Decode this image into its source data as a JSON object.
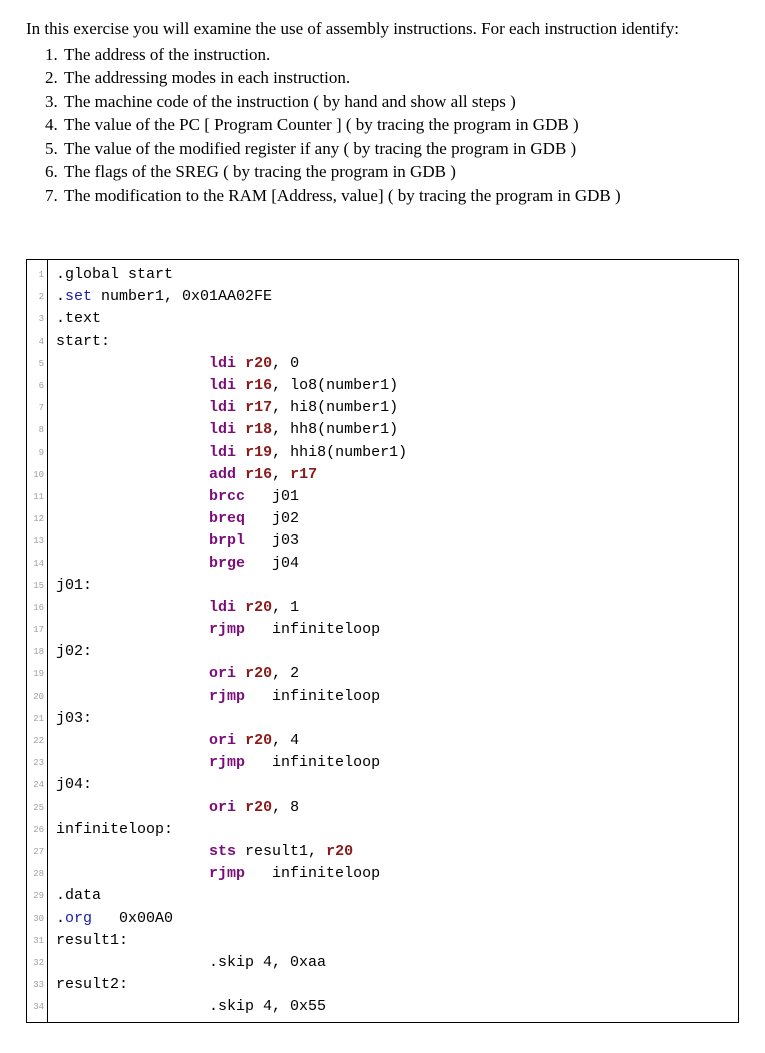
{
  "intro": "In this exercise you will examine the use of assembly instructions. For each instruction identify:",
  "list": [
    "The address of the instruction.",
    "The addressing modes in each instruction.",
    "The machine code of the instruction ( by hand and show all steps )",
    "The value of the PC [ Program Counter ] ( by tracing the program in GDB )",
    "The value of the modified register if any ( by tracing the program in GDB )",
    "The flags of the SREG ( by tracing the program in GDB )",
    "The modification to the RAM [Address, value] ( by tracing the program in GDB )"
  ],
  "code": [
    [
      {
        "t": ".global start",
        "c": "tok-plain"
      }
    ],
    [
      {
        "t": ".",
        "c": "tok-plain"
      },
      {
        "t": "set",
        "c": "tok-dir"
      },
      {
        "t": " number1, 0x01AA02FE",
        "c": "tok-plain"
      }
    ],
    [
      {
        "t": ".text",
        "c": "tok-plain"
      }
    ],
    [
      {
        "t": "start:",
        "c": "tok-plain"
      }
    ],
    [
      {
        "t": "                 ",
        "c": "tok-plain"
      },
      {
        "t": "ldi",
        "c": "tok-op"
      },
      {
        "t": " ",
        "c": "tok-plain"
      },
      {
        "t": "r20",
        "c": "tok-reg"
      },
      {
        "t": ", 0",
        "c": "tok-plain"
      }
    ],
    [
      {
        "t": "                 ",
        "c": "tok-plain"
      },
      {
        "t": "ldi",
        "c": "tok-op"
      },
      {
        "t": " ",
        "c": "tok-plain"
      },
      {
        "t": "r16",
        "c": "tok-reg"
      },
      {
        "t": ", lo8(number1)",
        "c": "tok-plain"
      }
    ],
    [
      {
        "t": "                 ",
        "c": "tok-plain"
      },
      {
        "t": "ldi",
        "c": "tok-op"
      },
      {
        "t": " ",
        "c": "tok-plain"
      },
      {
        "t": "r17",
        "c": "tok-reg"
      },
      {
        "t": ", hi8(number1)",
        "c": "tok-plain"
      }
    ],
    [
      {
        "t": "                 ",
        "c": "tok-plain"
      },
      {
        "t": "ldi",
        "c": "tok-op"
      },
      {
        "t": " ",
        "c": "tok-plain"
      },
      {
        "t": "r18",
        "c": "tok-reg"
      },
      {
        "t": ", hh8(number1)",
        "c": "tok-plain"
      }
    ],
    [
      {
        "t": "                 ",
        "c": "tok-plain"
      },
      {
        "t": "ldi",
        "c": "tok-op"
      },
      {
        "t": " ",
        "c": "tok-plain"
      },
      {
        "t": "r19",
        "c": "tok-reg"
      },
      {
        "t": ", hhi8(number1)",
        "c": "tok-plain"
      }
    ],
    [
      {
        "t": "                 ",
        "c": "tok-plain"
      },
      {
        "t": "add",
        "c": "tok-op"
      },
      {
        "t": " ",
        "c": "tok-plain"
      },
      {
        "t": "r16",
        "c": "tok-reg"
      },
      {
        "t": ", ",
        "c": "tok-plain"
      },
      {
        "t": "r17",
        "c": "tok-reg"
      }
    ],
    [
      {
        "t": "                 ",
        "c": "tok-plain"
      },
      {
        "t": "brcc",
        "c": "tok-op"
      },
      {
        "t": "   j01",
        "c": "tok-plain"
      }
    ],
    [
      {
        "t": "                 ",
        "c": "tok-plain"
      },
      {
        "t": "breq",
        "c": "tok-op"
      },
      {
        "t": "   j02",
        "c": "tok-plain"
      }
    ],
    [
      {
        "t": "                 ",
        "c": "tok-plain"
      },
      {
        "t": "brpl",
        "c": "tok-op"
      },
      {
        "t": "   j03",
        "c": "tok-plain"
      }
    ],
    [
      {
        "t": "                 ",
        "c": "tok-plain"
      },
      {
        "t": "brge",
        "c": "tok-op"
      },
      {
        "t": "   j04",
        "c": "tok-plain"
      }
    ],
    [
      {
        "t": "j01:",
        "c": "tok-plain"
      }
    ],
    [
      {
        "t": "                 ",
        "c": "tok-plain"
      },
      {
        "t": "ldi",
        "c": "tok-op"
      },
      {
        "t": " ",
        "c": "tok-plain"
      },
      {
        "t": "r20",
        "c": "tok-reg"
      },
      {
        "t": ", 1",
        "c": "tok-plain"
      }
    ],
    [
      {
        "t": "                 ",
        "c": "tok-plain"
      },
      {
        "t": "rjmp",
        "c": "tok-op"
      },
      {
        "t": "   infiniteloop",
        "c": "tok-plain"
      }
    ],
    [
      {
        "t": "j02:",
        "c": "tok-plain"
      }
    ],
    [
      {
        "t": "                 ",
        "c": "tok-plain"
      },
      {
        "t": "ori",
        "c": "tok-op"
      },
      {
        "t": " ",
        "c": "tok-plain"
      },
      {
        "t": "r20",
        "c": "tok-reg"
      },
      {
        "t": ", 2",
        "c": "tok-plain"
      }
    ],
    [
      {
        "t": "                 ",
        "c": "tok-plain"
      },
      {
        "t": "rjmp",
        "c": "tok-op"
      },
      {
        "t": "   infiniteloop",
        "c": "tok-plain"
      }
    ],
    [
      {
        "t": "j03:",
        "c": "tok-plain"
      }
    ],
    [
      {
        "t": "                 ",
        "c": "tok-plain"
      },
      {
        "t": "ori",
        "c": "tok-op"
      },
      {
        "t": " ",
        "c": "tok-plain"
      },
      {
        "t": "r20",
        "c": "tok-reg"
      },
      {
        "t": ", 4",
        "c": "tok-plain"
      }
    ],
    [
      {
        "t": "                 ",
        "c": "tok-plain"
      },
      {
        "t": "rjmp",
        "c": "tok-op"
      },
      {
        "t": "   infiniteloop",
        "c": "tok-plain"
      }
    ],
    [
      {
        "t": "j04:",
        "c": "tok-plain"
      }
    ],
    [
      {
        "t": "                 ",
        "c": "tok-plain"
      },
      {
        "t": "ori",
        "c": "tok-op"
      },
      {
        "t": " ",
        "c": "tok-plain"
      },
      {
        "t": "r20",
        "c": "tok-reg"
      },
      {
        "t": ", 8",
        "c": "tok-plain"
      }
    ],
    [
      {
        "t": "infiniteloop:",
        "c": "tok-plain"
      }
    ],
    [
      {
        "t": "                 ",
        "c": "tok-plain"
      },
      {
        "t": "sts",
        "c": "tok-op"
      },
      {
        "t": " result1, ",
        "c": "tok-plain"
      },
      {
        "t": "r20",
        "c": "tok-reg"
      }
    ],
    [
      {
        "t": "                 ",
        "c": "tok-plain"
      },
      {
        "t": "rjmp",
        "c": "tok-op"
      },
      {
        "t": "   infiniteloop",
        "c": "tok-plain"
      }
    ],
    [
      {
        "t": ".data",
        "c": "tok-plain"
      }
    ],
    [
      {
        "t": ".",
        "c": "tok-plain"
      },
      {
        "t": "org",
        "c": "tok-dir"
      },
      {
        "t": "   0x00A0",
        "c": "tok-plain"
      }
    ],
    [
      {
        "t": "result1:",
        "c": "tok-plain"
      }
    ],
    [
      {
        "t": "                 .skip 4, 0xaa",
        "c": "tok-plain"
      }
    ],
    [
      {
        "t": "result2:",
        "c": "tok-plain"
      }
    ],
    [
      {
        "t": "                 .skip 4, 0x55",
        "c": "tok-plain"
      }
    ]
  ]
}
